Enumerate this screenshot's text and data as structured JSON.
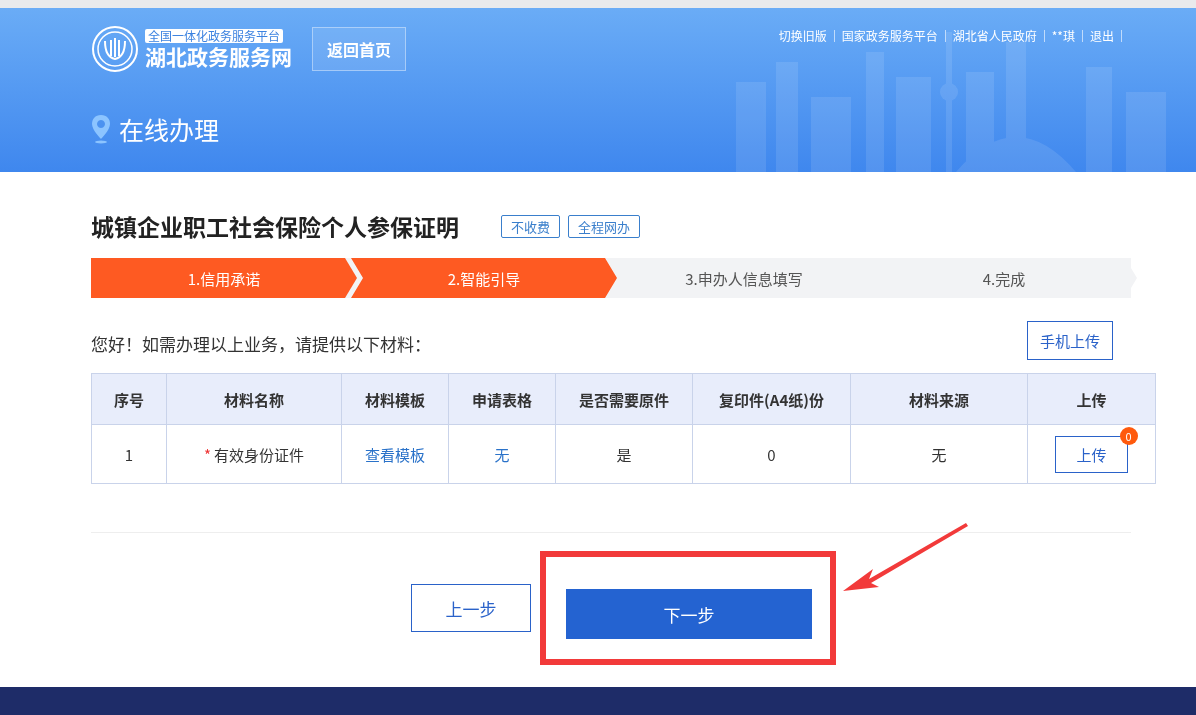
{
  "header": {
    "platform_tag": "全国一体化政务服务平台",
    "site_name": "湖北政务服务网",
    "home_button": "返回首页",
    "top_links": [
      "切换旧版",
      "国家政务服务平台",
      "湖北省人民政府",
      "**琪",
      "退出"
    ],
    "page_title": "在线办理"
  },
  "service": {
    "title": "城镇企业职工社会保险个人参保证明",
    "tags": [
      "不收费",
      "全程网办"
    ]
  },
  "steps": [
    {
      "label": "1.信用承诺",
      "done": true
    },
    {
      "label": "2.智能引导",
      "done": true
    },
    {
      "label": "3.申办人信息填写",
      "done": false
    },
    {
      "label": "4.完成",
      "done": false
    }
  ],
  "intro": "您好！如需办理以上业务，请提供以下材料：",
  "mobile_upload_button": "手机上传",
  "table": {
    "columns": [
      "序号",
      "材料名称",
      "材料模板",
      "申请表格",
      "是否需要原件",
      "复印件(A4纸)份",
      "材料来源",
      "上传"
    ],
    "rows": [
      [
        {
          "kind": "text",
          "text": "1"
        },
        {
          "kind": "required",
          "mark": "*",
          "text": "有效身份证件"
        },
        {
          "kind": "link",
          "text": "查看模板"
        },
        {
          "kind": "link",
          "text": "无"
        },
        {
          "kind": "text",
          "text": "是"
        },
        {
          "kind": "text",
          "text": "0"
        },
        {
          "kind": "text",
          "text": "无"
        },
        {
          "kind": "button",
          "text": "上传",
          "badge": "0"
        }
      ]
    ]
  },
  "buttons": {
    "prev": "上一步",
    "next": "下一步"
  }
}
